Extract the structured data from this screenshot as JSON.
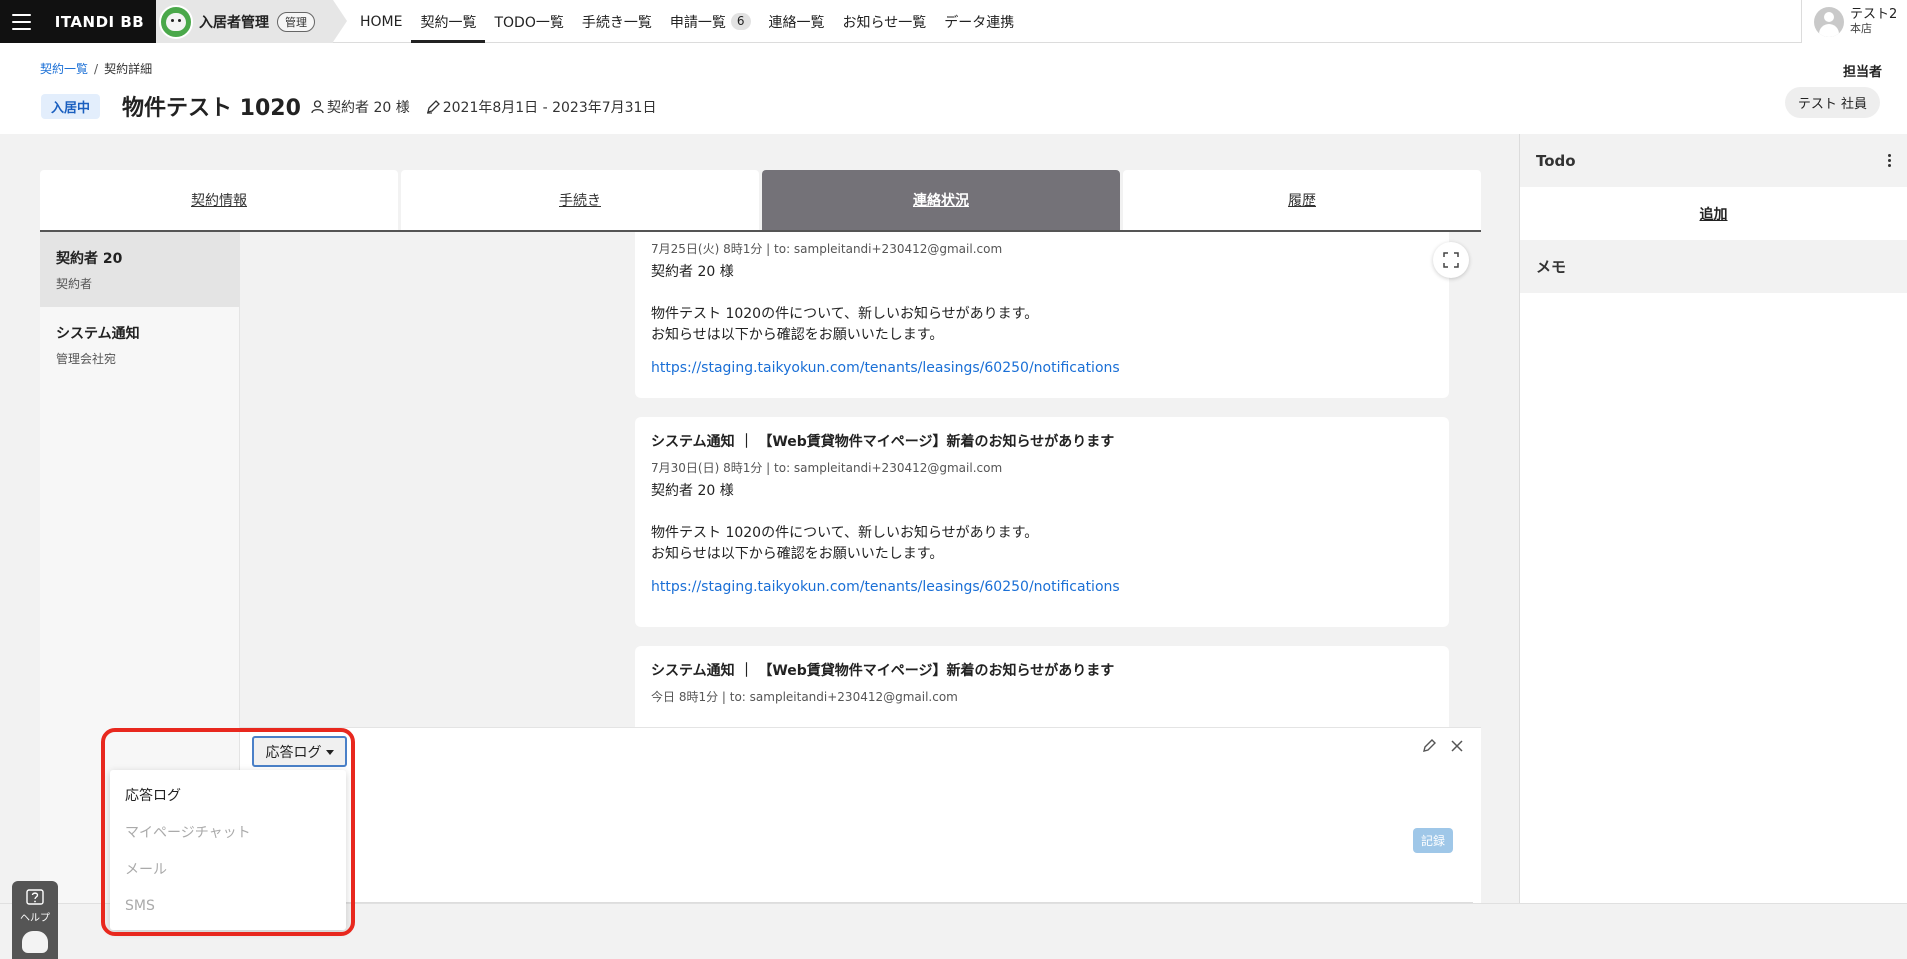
{
  "nav": {
    "brand": "ITANDI BB",
    "product_name": "入居者管理",
    "product_badge": "管理",
    "items": [
      {
        "label": "HOME"
      },
      {
        "label": "契約一覧",
        "active": true
      },
      {
        "label": "TODO一覧"
      },
      {
        "label": "手続き一覧"
      },
      {
        "label": "申請一覧",
        "count": "6"
      },
      {
        "label": "連絡一覧"
      },
      {
        "label": "お知らせ一覧"
      },
      {
        "label": "データ連携"
      }
    ],
    "user_name": "テスト2",
    "user_store": "本店"
  },
  "breadcrumb": {
    "parent": "契約一覧",
    "current": "契約詳細"
  },
  "header": {
    "status": "入居中",
    "title": "物件テスト 1020",
    "tenant": "契約者 20 様",
    "period": "2021年8月1日 - 2023年7月31日",
    "assignee_label": "担当者",
    "assignee_name": "テスト 社員"
  },
  "tabs": [
    {
      "label": "契約情報"
    },
    {
      "label": "手続き"
    },
    {
      "label": "連絡状況",
      "active": true
    },
    {
      "label": "履歴"
    }
  ],
  "contacts": [
    {
      "name": "契約者 20",
      "role": "契約者",
      "active": true
    },
    {
      "name": "システム通知",
      "role": "管理会社宛"
    }
  ],
  "messages": [
    {
      "head": "",
      "meta": "7月25日(火) 8時1分  |  to: sampleitandi+230412@gmail.com",
      "body": "契約者 20 様\n\n物件テスト 1020の件について、新しいお知らせがあります。\nお知らせは以下から確認をお願いいたします。",
      "link": "https://staging.taikyokun.com/tenants/leasings/60250/notifications"
    },
    {
      "head": "システム通知 ｜ 【Web賃貸物件マイページ】新着のお知らせがあります",
      "meta": "7月30日(日) 8時1分  |  to: sampleitandi+230412@gmail.com",
      "body": "契約者 20 様\n\n物件テスト 1020の件について、新しいお知らせがあります。\nお知らせは以下から確認をお願いいたします。",
      "link": "https://staging.taikyokun.com/tenants/leasings/60250/notifications"
    },
    {
      "head": "システム通知 ｜ 【Web賃貸物件マイページ】新着のお知らせがあります",
      "meta": "今日 8時1分  |  to: sampleitandi+230412@gmail.com",
      "body": "",
      "link": ""
    }
  ],
  "composer": {
    "type_selected": "応答ログ",
    "options": [
      "応答ログ",
      "マイページチャット",
      "メール",
      "SMS"
    ],
    "record_label": "記録"
  },
  "sidebar": {
    "todo_title": "Todo",
    "todo_add": "追加",
    "memo_title": "メモ"
  },
  "help": {
    "label": "ヘルプ"
  },
  "colors": {
    "accent": "#1a6fd6",
    "active_tab": "#747278",
    "highlight": "#e8281e"
  }
}
